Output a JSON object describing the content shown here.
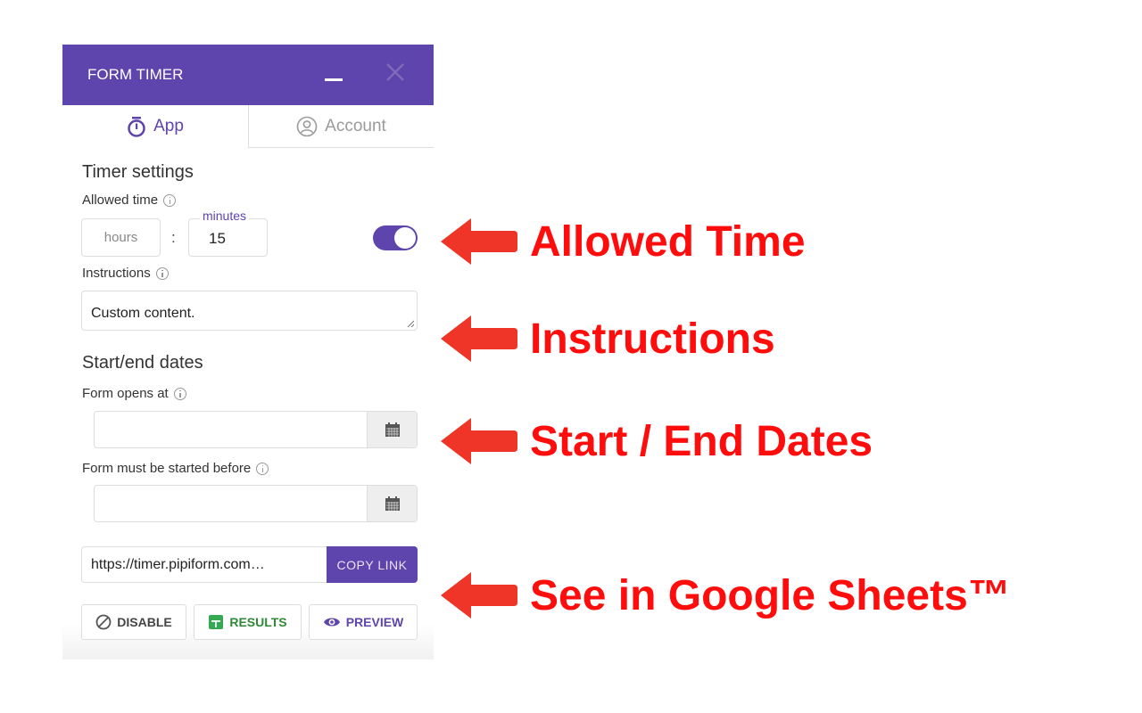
{
  "window": {
    "title": "FORM TIMER",
    "minimize_icon": "minimize-icon",
    "close_icon": "close-icon"
  },
  "tabs": [
    {
      "label": "App",
      "icon": "stopwatch-icon",
      "active": true
    },
    {
      "label": "Account",
      "icon": "user-circle-icon",
      "active": false
    }
  ],
  "timer_settings": {
    "heading": "Timer settings",
    "allowed_time_label": "Allowed time",
    "hours_placeholder": "hours",
    "hours_value": "",
    "separator": ":",
    "minutes_label": "minutes",
    "minutes_value": "15",
    "toggle_on": true,
    "instructions_label": "Instructions",
    "instructions_value": "Custom content."
  },
  "dates": {
    "heading": "Start/end dates",
    "opens_label": "Form opens at",
    "opens_value": "",
    "started_before_label": "Form must be started before",
    "started_before_value": ""
  },
  "link": {
    "url": "https://timer.pipiform.com…",
    "copy_label": "COPY LINK"
  },
  "actions": {
    "disable_label": "DISABLE",
    "results_label": "RESULTS",
    "preview_label": "PREVIEW"
  },
  "annotations": [
    {
      "text": "Allowed Time"
    },
    {
      "text": "Instructions"
    },
    {
      "text": "Start / End Dates"
    },
    {
      "text": "See in Google Sheets™"
    }
  ],
  "colors": {
    "brand": "#5e44ad",
    "results_green": "#2e8a36",
    "annotation_red": "#ff0c0c",
    "arrow_red": "#ee3527"
  }
}
